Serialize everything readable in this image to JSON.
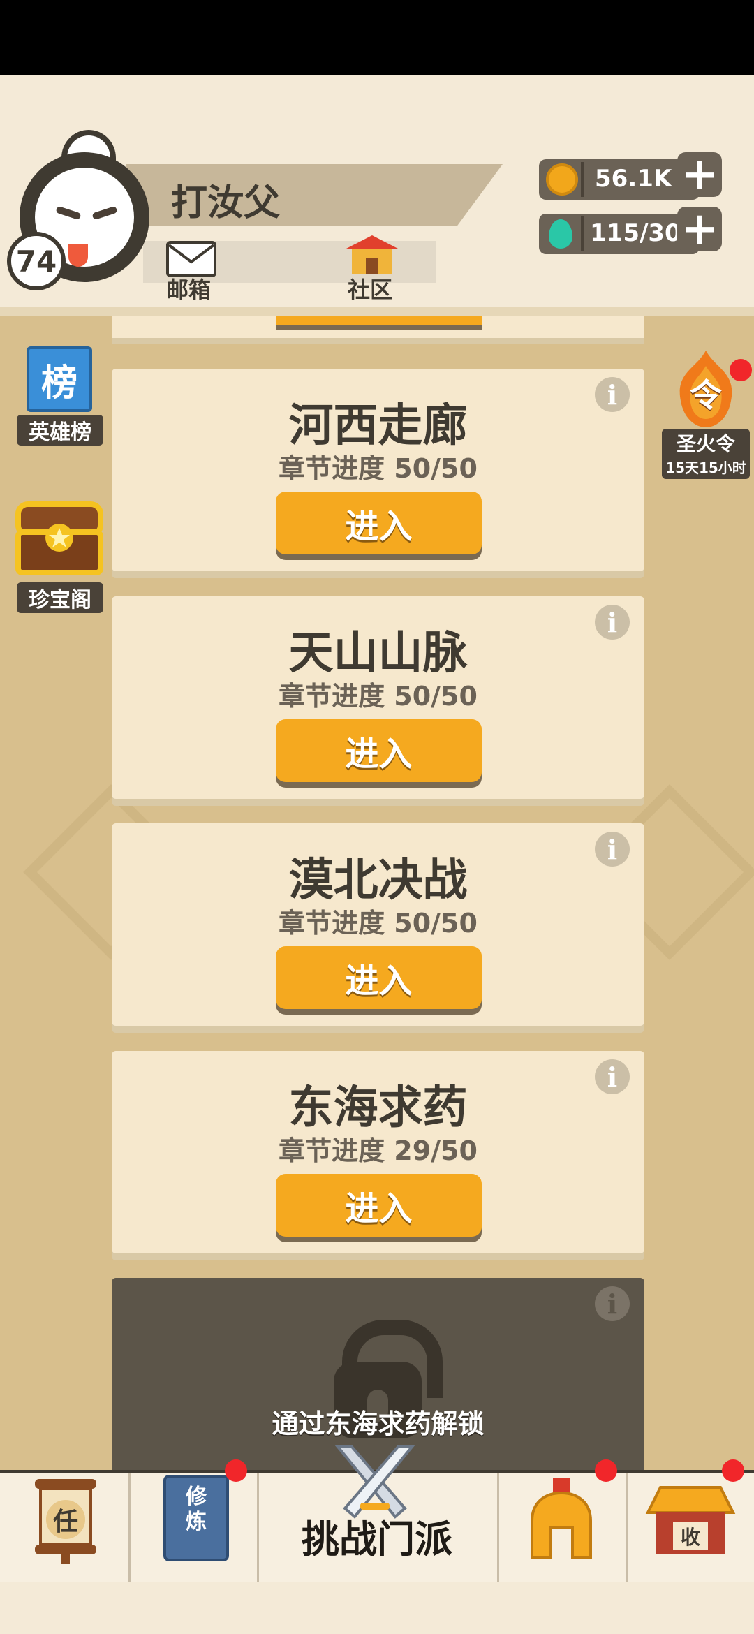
{
  "player": {
    "name": "打汝父",
    "level": "74"
  },
  "shortcuts": {
    "mail_label": "邮箱",
    "community_label": "社区"
  },
  "resources": {
    "coins": "56.1K",
    "gems": "115/30"
  },
  "left_side": {
    "ranking_badge": "榜",
    "ranking_label": "英雄榜",
    "treasure_label": "珍宝阁"
  },
  "right_side": {
    "token_badge": "令",
    "token_label": "圣火令",
    "token_timer": "15天15小时"
  },
  "chapters": [
    {
      "title": "河西走廊",
      "progress": "章节进度 50/50",
      "button": "进入"
    },
    {
      "title": "天山山脉",
      "progress": "章节进度 50/50",
      "button": "进入"
    },
    {
      "title": "漠北决战",
      "progress": "章节进度 50/50",
      "button": "进入"
    },
    {
      "title": "东海求药",
      "progress": "章节进度 29/50",
      "button": "进入"
    }
  ],
  "locked_chapter": {
    "text": "通过东海求药解锁"
  },
  "info_icon_text": "i",
  "bottom_nav": {
    "task_badge": "任",
    "cultivate_badge": "修炼",
    "challenge_label": "挑战门派",
    "collect_badge": "收"
  },
  "colors": {
    "accent": "#f5a91f",
    "background": "#d8bf8d",
    "card": "#f6e8cd",
    "dark": "#3f3a31",
    "notification": "#f1262a"
  }
}
